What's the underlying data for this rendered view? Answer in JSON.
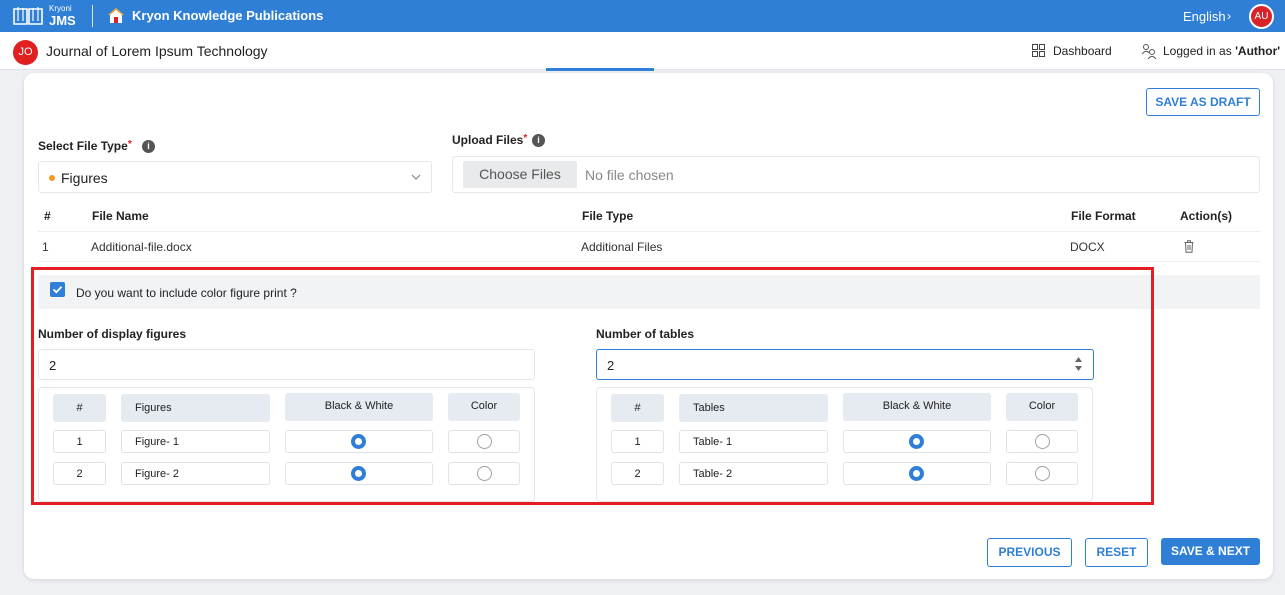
{
  "topbar": {
    "brand_small": "Kryoni",
    "brand_big": "JMS",
    "publisher": "Kryon Knowledge Publications",
    "language": "English",
    "user_initials": "AU"
  },
  "subbar": {
    "journal_initials": "JO",
    "journal_title": "Journal of Lorem Ipsum Technology",
    "dashboard_label": "Dashboard",
    "logged_in_prefix": "Logged in as ",
    "logged_in_role": "'Author'"
  },
  "actions": {
    "save_draft": "SAVE AS DRAFT",
    "previous": "PREVIOUS",
    "reset": "RESET",
    "save_next": "SAVE & NEXT"
  },
  "form": {
    "file_type_label": "Select File Type",
    "file_type_value": "Figures",
    "upload_label": "Upload Files",
    "choose_files": "Choose Files",
    "no_file": "No file chosen",
    "required_mark": "*",
    "info_glyph": "i"
  },
  "files_table": {
    "headers": [
      "#",
      "File Name",
      "File Type",
      "File Format",
      "Action(s)"
    ],
    "rows": [
      {
        "num": "1",
        "name": "Additional-file.docx",
        "type": "Additional Files",
        "format": "DOCX"
      }
    ]
  },
  "color_print": {
    "question": "Do you want to include color figure print ?",
    "checked": true,
    "figures_label": "Number of display figures",
    "figures_count": "2",
    "tables_label": "Number of tables",
    "tables_count": "2",
    "figures_headers": [
      "#",
      "Figures",
      "Black & White",
      "Color"
    ],
    "figures_rows": [
      {
        "num": "1",
        "name": "Figure- 1",
        "selected": "Black & White"
      },
      {
        "num": "2",
        "name": "Figure- 2",
        "selected": "Black & White"
      }
    ],
    "tables_headers": [
      "#",
      "Tables",
      "Black & White",
      "Color"
    ],
    "tables_rows": [
      {
        "num": "1",
        "name": "Table- 1",
        "selected": "Black & White"
      },
      {
        "num": "2",
        "name": "Table- 2",
        "selected": "Black & White"
      }
    ]
  },
  "colors": {
    "primary": "#2f7fd6",
    "highlight_frame": "#e31e24",
    "avatar_red": "#d9232a"
  }
}
